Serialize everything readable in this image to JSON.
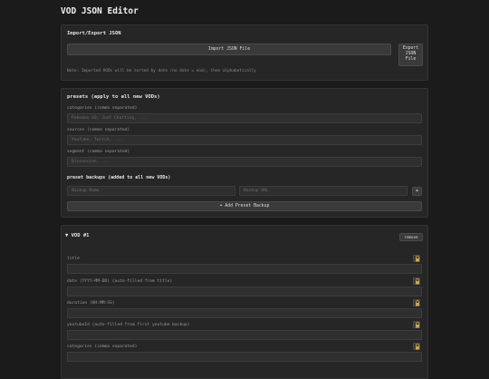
{
  "app": {
    "title": "VOD JSON Editor"
  },
  "import_export": {
    "heading": "Import/Export JSON",
    "import_button": "Import JSON File",
    "export_button_lines": [
      "Export",
      "JSON",
      "File"
    ],
    "note": "Note: Imported VODs will be sorted by date (no date = end), then alphabetically"
  },
  "presets": {
    "heading": "presets (apply to all new VODs)",
    "categories_label": "categories (comma separated)",
    "categories_placeholder": "Pokemon GO, Just Chatting, ...",
    "sources_label": "sources (comma separated)",
    "sources_placeholder": "YouTube, Twitch, ...",
    "segment_label": "segment (comma separated)",
    "segment_placeholder": "Discussion, ...",
    "backups_heading": "preset backups (added to all new VODs)",
    "backup_name_placeholder": "Backup Name",
    "backup_url_placeholder": "Backup URL",
    "remove_symbol": "×",
    "add_backup_button": "+ Add Preset Backup"
  },
  "vod": {
    "heading": "▼ VOD #1",
    "remove_button": "remove",
    "fields": [
      {
        "label": "title"
      },
      {
        "label": "date (YYYY-MM-DD) (auto-filled from title)"
      },
      {
        "label": "duration (HH:MM:SS)"
      },
      {
        "label": "youtubeId (auto-filled from first youtube backup)"
      },
      {
        "label": "categories (comma separated)"
      }
    ]
  },
  "colors": {
    "background": "#1b1b1b",
    "panel": "#262626",
    "lock_accent": "#d4a53c"
  }
}
